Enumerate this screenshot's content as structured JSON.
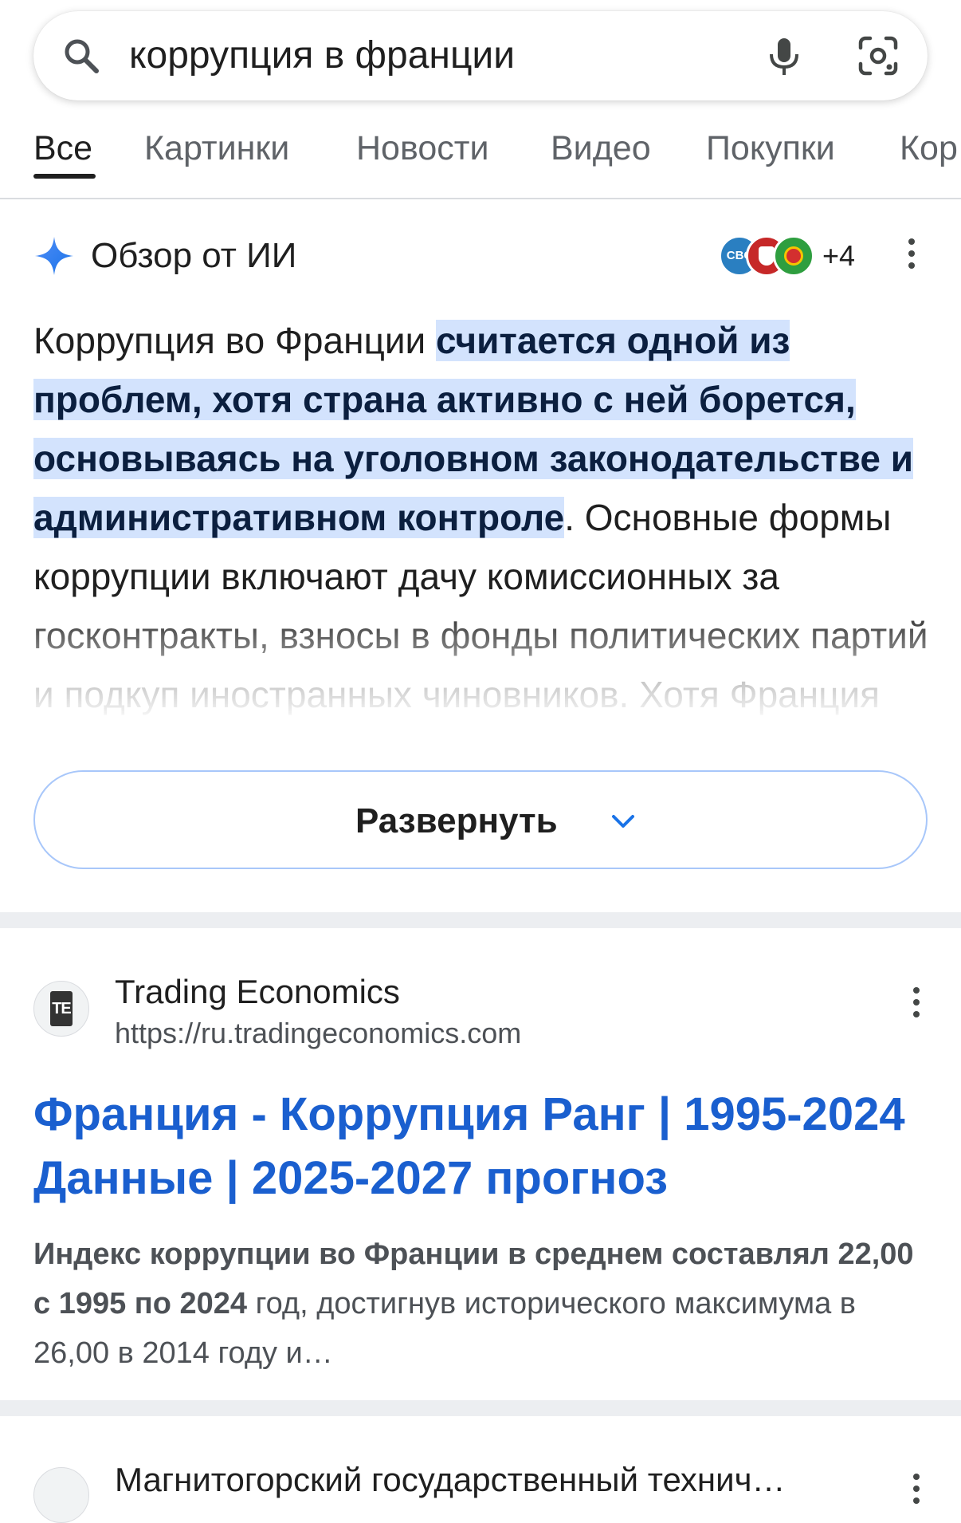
{
  "search": {
    "query": "коррупция в франции",
    "icons": {
      "search": "search-icon",
      "voice": "mic-icon",
      "lens": "camera-lens-icon"
    }
  },
  "tabs": [
    {
      "label": "Все",
      "active": true
    },
    {
      "label": "Картинки"
    },
    {
      "label": "Новости"
    },
    {
      "label": "Видео"
    },
    {
      "label": "Покупки"
    },
    {
      "label": "Кор"
    }
  ],
  "ai_overview": {
    "title": "Обзор от ИИ",
    "sources_more": "+4",
    "source_badge": "CBC",
    "text_part1": "Коррупция во Франции ",
    "text_highlight": "считается одной из проблем, хотя страна активно с ней борется, основываясь на уголовном законодательстве и административном контроле",
    "text_part2": ". Основные формы коррупции включают дачу комиссионных за госконтракты, взносы в фонды политических партий и подкуп иностранных чиновников. Хотя Франция имеет",
    "expand_label": "Развернуть",
    "accent_color": "#1a73e8",
    "highlight_color": "#d3e3fd"
  },
  "results": [
    {
      "site": "Trading Economics",
      "url": "https://ru.tradingeconomics.com",
      "favicon_text": "TE",
      "title": "Франция - Коррупция Ранг | 1995-2024 Данные | 2025-2027 прогноз",
      "snippet_bold": "Индекс коррупции во Франции в среднем составлял 22,00 с 1995 по 2024",
      "snippet_rest": " год, достигнув исторического максимума в 26,00 в 2014 году и…"
    },
    {
      "site": "Магнитогорский государственный технич…"
    }
  ],
  "colors": {
    "link": "#1a5fcf",
    "separator": "#eceef1"
  }
}
